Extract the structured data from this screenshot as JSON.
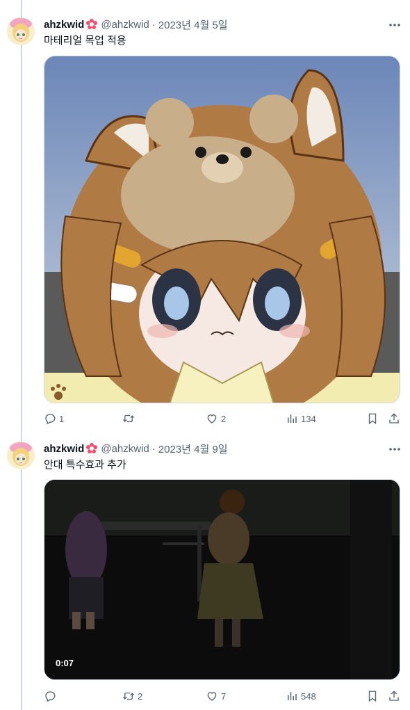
{
  "tweets": [
    {
      "author_name": "ahzkwid",
      "handle": "@ahzkwid",
      "separator": "·",
      "date": "2023년 4월 5일",
      "text": "마테리얼 목업 적용",
      "media_type": "image",
      "stats": {
        "replies": "1",
        "retweets": "",
        "likes": "2",
        "views": "134"
      }
    },
    {
      "author_name": "ahzkwid",
      "handle": "@ahzkwid",
      "separator": "·",
      "date": "2023년 4월 9일",
      "text": "안대 특수효과 추가",
      "media_type": "video",
      "video_duration": "0:07",
      "stats": {
        "replies": "",
        "retweets": "2",
        "likes": "7",
        "views": "548"
      }
    }
  ],
  "icons": {
    "more": "more-icon",
    "reply": "reply-icon",
    "retweet": "retweet-icon",
    "like": "heart-icon",
    "views": "views-icon",
    "bookmark": "bookmark-icon",
    "share": "share-icon",
    "badge": "flower-badge-icon"
  },
  "colors": {
    "text_primary": "#0f1419",
    "text_secondary": "#536471",
    "border": "#cfd9de",
    "badge": "#f0506e"
  }
}
